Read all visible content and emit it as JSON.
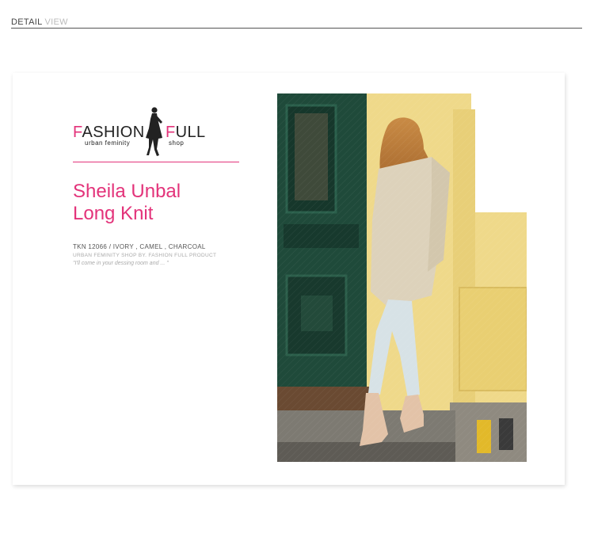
{
  "header": {
    "main": "DETAIL",
    "sub": "VIEW"
  },
  "logo": {
    "left_initial": "F",
    "left_rest": "ASHION",
    "right_initial": "F",
    "right_rest": "ULL",
    "tag_left": "urban feminity",
    "tag_right": "shop"
  },
  "product": {
    "title_line1": "Sheila Unbal",
    "title_line2": "Long Knit",
    "info_line1": "TKN 12066 / IVORY , CAMEL , CHARCOAL",
    "info_line2": "URBAN FEMINITY SHOP BY. FASHION FULL PRODUCT",
    "info_line3": "\"I'll come in your dessing room and ... \""
  },
  "colors": {
    "accent": "#e3337a",
    "door": "#1f4a3a",
    "wall": "#f2dd8a"
  }
}
